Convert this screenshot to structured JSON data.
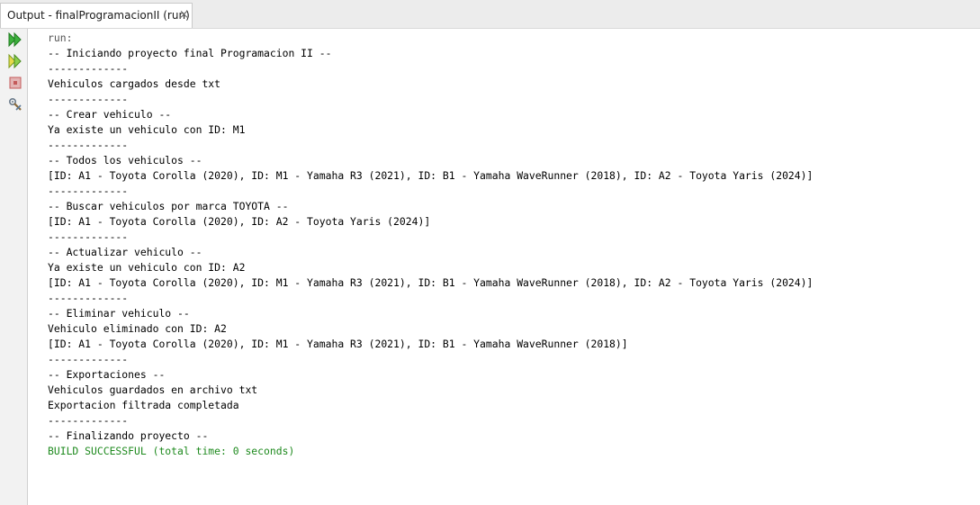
{
  "tab": {
    "title": "Output - finalProgramacionII (run)",
    "close_glyph": "×"
  },
  "toolbar": {
    "icons": [
      "rerun-icon",
      "rerun-with-options-icon",
      "stop-icon",
      "settings-icon"
    ]
  },
  "colors": {
    "rerun_green": "#2ea02e",
    "success_text": "#1e8a1e",
    "stop_red": "#c45a5a"
  },
  "console": {
    "lines": [
      {
        "text": "run:",
        "style": "muted"
      },
      {
        "text": "-- Iniciando proyecto final Programacion II --",
        "style": "normal"
      },
      {
        "text": "-------------",
        "style": "normal"
      },
      {
        "text": "Vehiculos cargados desde txt",
        "style": "normal"
      },
      {
        "text": "-------------",
        "style": "normal"
      },
      {
        "text": "-- Crear vehiculo --",
        "style": "normal"
      },
      {
        "text": "Ya existe un vehiculo con ID: M1",
        "style": "normal"
      },
      {
        "text": "-------------",
        "style": "normal"
      },
      {
        "text": "-- Todos los vehiculos --",
        "style": "normal"
      },
      {
        "text": "[ID: A1 - Toyota Corolla (2020), ID: M1 - Yamaha R3 (2021), ID: B1 - Yamaha WaveRunner (2018), ID: A2 - Toyota Yaris (2024)]",
        "style": "normal"
      },
      {
        "text": "-------------",
        "style": "normal"
      },
      {
        "text": "-- Buscar vehiculos por marca TOYOTA --",
        "style": "normal"
      },
      {
        "text": "[ID: A1 - Toyota Corolla (2020), ID: A2 - Toyota Yaris (2024)]",
        "style": "normal"
      },
      {
        "text": "-------------",
        "style": "normal"
      },
      {
        "text": "-- Actualizar vehiculo --",
        "style": "normal"
      },
      {
        "text": "Ya existe un vehiculo con ID: A2",
        "style": "normal"
      },
      {
        "text": "[ID: A1 - Toyota Corolla (2020), ID: M1 - Yamaha R3 (2021), ID: B1 - Yamaha WaveRunner (2018), ID: A2 - Toyota Yaris (2024)]",
        "style": "normal"
      },
      {
        "text": "-------------",
        "style": "normal"
      },
      {
        "text": "-- Eliminar vehiculo --",
        "style": "normal"
      },
      {
        "text": "Vehiculo eliminado con ID: A2",
        "style": "normal"
      },
      {
        "text": "[ID: A1 - Toyota Corolla (2020), ID: M1 - Yamaha R3 (2021), ID: B1 - Yamaha WaveRunner (2018)]",
        "style": "normal"
      },
      {
        "text": "-------------",
        "style": "normal"
      },
      {
        "text": "-- Exportaciones --",
        "style": "normal"
      },
      {
        "text": "Vehiculos guardados en archivo txt",
        "style": "normal"
      },
      {
        "text": "Exportacion filtrada completada",
        "style": "normal"
      },
      {
        "text": "-------------",
        "style": "normal"
      },
      {
        "text": "-- Finalizando proyecto --",
        "style": "normal"
      },
      {
        "text": "BUILD SUCCESSFUL (total time: 0 seconds)",
        "style": "success"
      }
    ]
  }
}
